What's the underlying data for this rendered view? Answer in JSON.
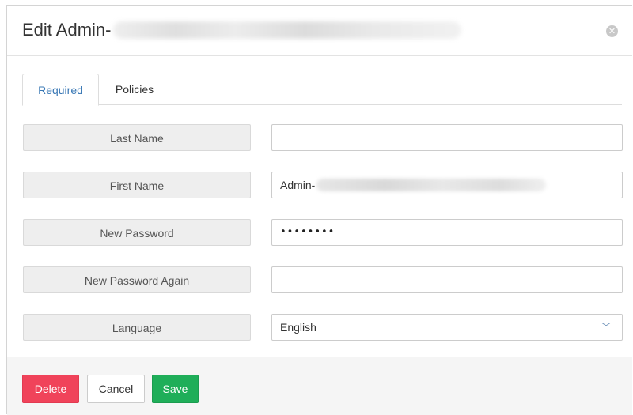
{
  "modal": {
    "title": "Edit Admin-",
    "title_redacted": true,
    "close_icon": "close-circle-icon"
  },
  "tabs": [
    {
      "label": "Required",
      "active": true
    },
    {
      "label": "Policies",
      "active": false
    }
  ],
  "form": {
    "fields": [
      {
        "label": "Last Name",
        "value": "",
        "type": "text"
      },
      {
        "label": "First Name",
        "value": "Admin-",
        "value_redacted": true,
        "type": "text"
      },
      {
        "label": "New Password",
        "value": "••••••••",
        "type": "password"
      },
      {
        "label": "New Password Again",
        "value": "",
        "type": "password"
      },
      {
        "label": "Language",
        "value": "English",
        "type": "select",
        "icon": "chevron-down-icon"
      }
    ]
  },
  "footer": {
    "delete_label": "Delete",
    "cancel_label": "Cancel",
    "save_label": "Save"
  },
  "colors": {
    "delete": "#f0435a",
    "save": "#1fae59",
    "active_tab": "#3a78b5"
  }
}
